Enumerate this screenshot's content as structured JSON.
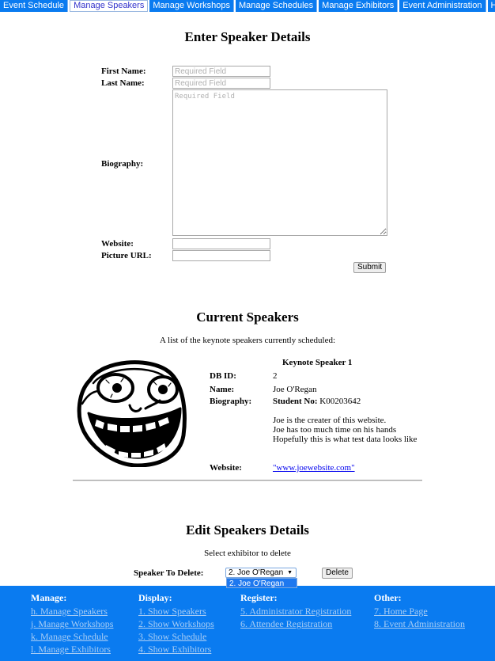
{
  "nav": {
    "tabs": [
      {
        "label": "Event Schedule",
        "active": false
      },
      {
        "label": "Manage Speakers",
        "active": true
      },
      {
        "label": "Manage Workshops",
        "active": false
      },
      {
        "label": "Manage Schedules",
        "active": false
      },
      {
        "label": "Manage Exhibitors",
        "active": false
      },
      {
        "label": "Event Administration",
        "active": false
      },
      {
        "label": "Home",
        "active": false
      }
    ]
  },
  "enter_form": {
    "title": "Enter Speaker Details",
    "first_name_label": "First Name:",
    "first_name_placeholder": "Required Field",
    "first_name_value": "",
    "last_name_label": "Last Name:",
    "last_name_placeholder": "Required Field",
    "last_name_value": "",
    "biography_label": "Biography:",
    "biography_placeholder": "Required Field",
    "biography_value": "",
    "website_label": "Website:",
    "website_value": "",
    "picture_label": "Picture URL:",
    "picture_value": "",
    "submit_label": "Submit"
  },
  "current": {
    "title": "Current Speakers",
    "subtitle": "A list of the keynote speakers currently scheduled:",
    "speaker": {
      "heading": "Keynote Speaker 1",
      "picture_icon": "troll-face-image",
      "db_id_label": "DB ID:",
      "db_id": "2",
      "name_label": "Name:",
      "name": "Joe O'Regan",
      "bio_label": "Biography:",
      "bio_student_label": "Student No:",
      "bio_student_no": "K00203642",
      "bio_lines": [
        "Joe is the creater of this website.",
        "Joe has too much time on his hands",
        "Hopefully this is what test data looks like"
      ],
      "website_label": "Website:",
      "website": "\"www.joewebsite.com\""
    }
  },
  "edit": {
    "title": "Edit Speakers Details",
    "subtitle": "Select exhibitor to delete",
    "delete_label": "Speaker To Delete:",
    "selected": "2. Joe O'Regan",
    "options": [
      "2. Joe O'Regan"
    ],
    "arrow_icon": "▼",
    "delete_button": "Delete"
  },
  "footer": {
    "columns": [
      {
        "heading": "Manage:",
        "links": [
          "h. Manage Speakers",
          "j. Manage Workshops",
          "k. Manage Schedule",
          "l. Manage Exhibitors"
        ]
      },
      {
        "heading": "Display:",
        "links": [
          "1. Show Speakers",
          "2. Show Workshops",
          "3. Show Schedule",
          "4. Show Exhibitors"
        ]
      },
      {
        "heading": "Register:",
        "links": [
          "5. Administrator Registration",
          "6. Attendee Registration"
        ]
      },
      {
        "heading": "Other:",
        "links": [
          "7. Home Page",
          "8. Event Administration"
        ]
      }
    ]
  },
  "colors": {
    "nav_bg": "#0a7bf0",
    "footer_bg": "#0a7bf0",
    "footer_link": "#a8cdf5",
    "link": "#0000ee"
  }
}
